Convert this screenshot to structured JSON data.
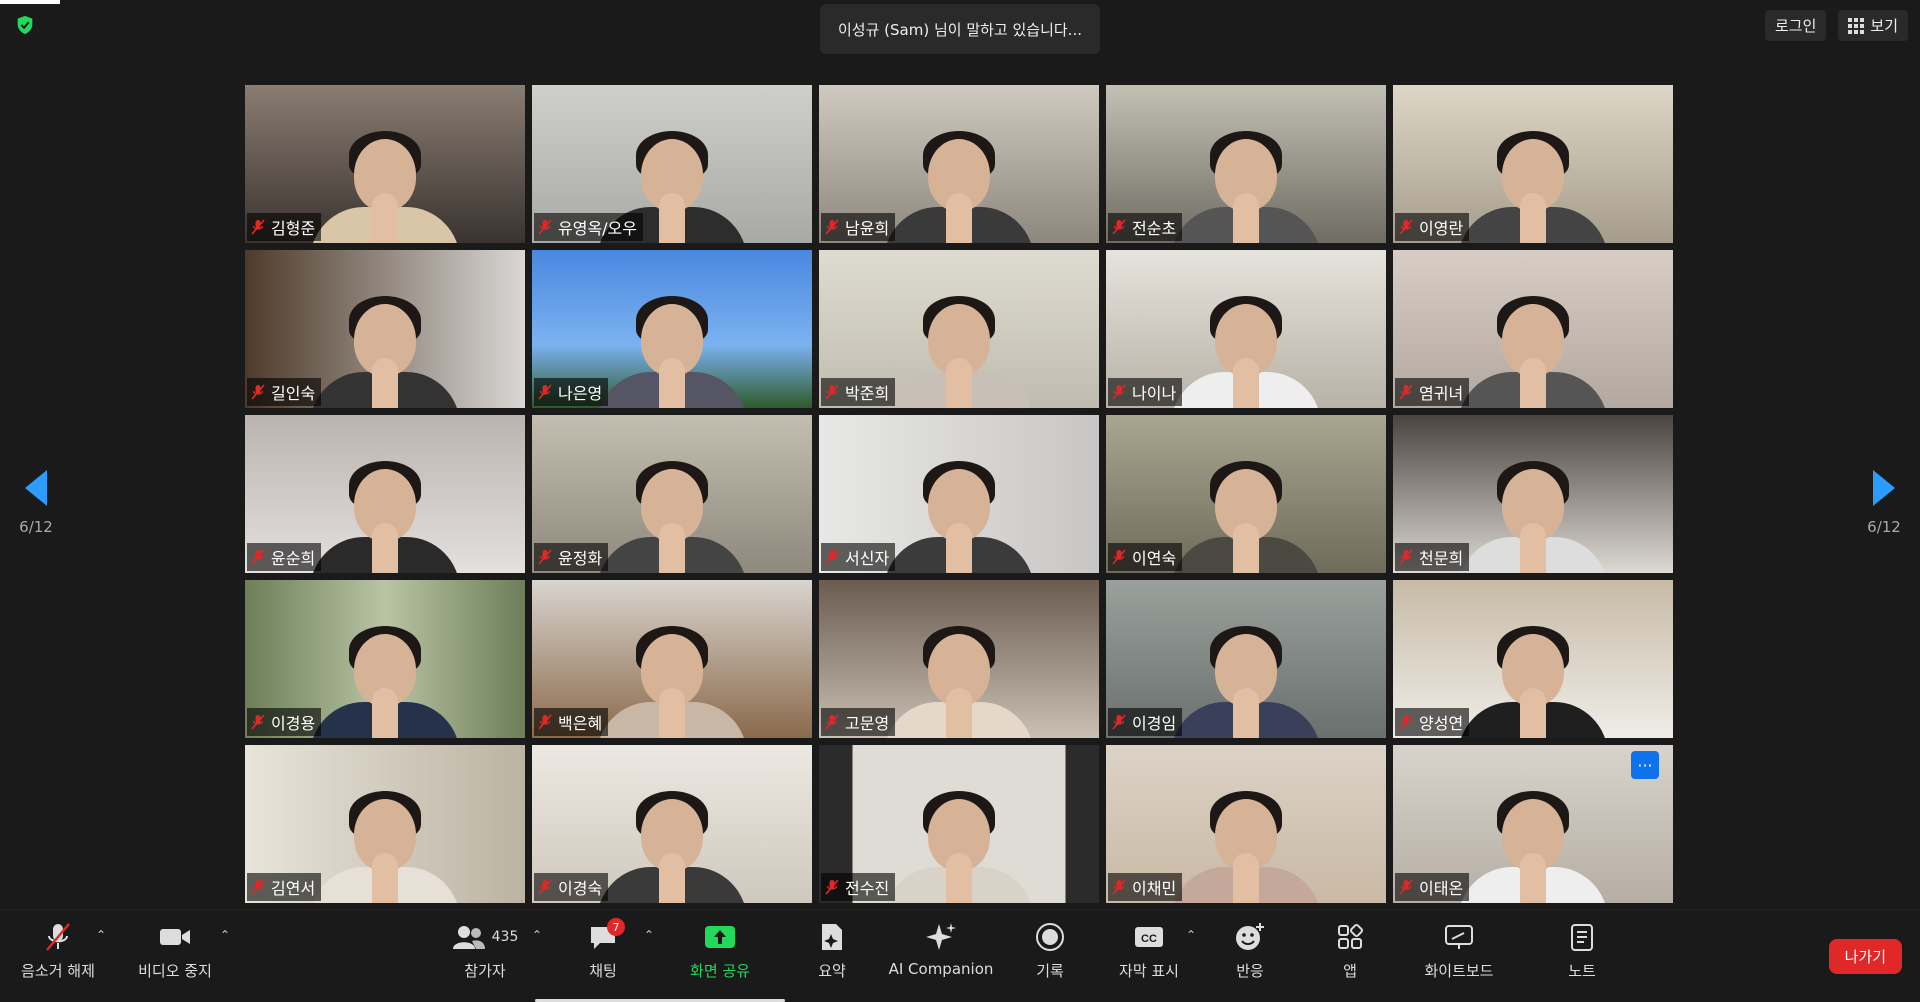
{
  "speaker_banner": "이성규 (Sam) 님이 말하고 있습니다...",
  "top_right": {
    "login": "로그인",
    "view": "보기"
  },
  "pagination": {
    "left": "6/12",
    "right": "6/12"
  },
  "accent": "#2d9cff",
  "participants": [
    {
      "name": "김형준"
    },
    {
      "name": "유영옥/오우"
    },
    {
      "name": "남윤희"
    },
    {
      "name": "전순초"
    },
    {
      "name": "이영란"
    },
    {
      "name": "길인숙"
    },
    {
      "name": "나은영"
    },
    {
      "name": "박준희"
    },
    {
      "name": "나이나"
    },
    {
      "name": "염귀녀"
    },
    {
      "name": "윤순희"
    },
    {
      "name": "윤정화"
    },
    {
      "name": "서신자"
    },
    {
      "name": "이연숙"
    },
    {
      "name": "천문희"
    },
    {
      "name": "이경용"
    },
    {
      "name": "백은혜"
    },
    {
      "name": "고문영"
    },
    {
      "name": "이경임"
    },
    {
      "name": "양성연"
    },
    {
      "name": "김연서"
    },
    {
      "name": "이경숙"
    },
    {
      "name": "전수진"
    },
    {
      "name": "이채민"
    },
    {
      "name": "이태온"
    }
  ],
  "toolbar": {
    "unmute": "음소거 해제",
    "stop_video": "비디오 중지",
    "participants": "참가자",
    "participants_count": "435",
    "chat": "채팅",
    "chat_badge": "7",
    "share_screen": "화면 공유",
    "summary": "요약",
    "ai_companion": "AI Companion",
    "record": "기록",
    "captions": "자막 표시",
    "reactions": "반응",
    "apps": "앱",
    "whiteboard": "화이트보드",
    "notes": "노트",
    "leave": "나가기"
  }
}
